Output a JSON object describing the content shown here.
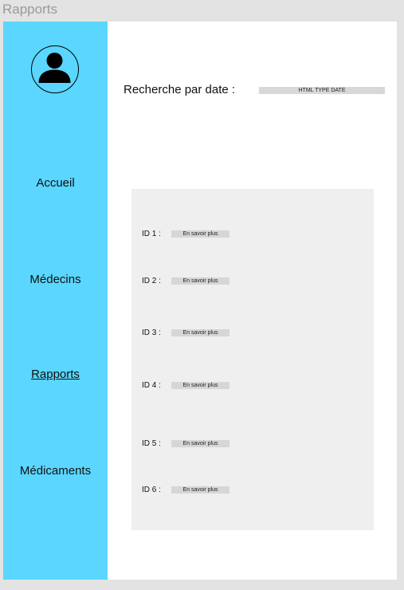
{
  "window": {
    "title": "Rapports"
  },
  "sidebar": {
    "avatar_icon": "user-icon",
    "accent_color": "#5ad6ff",
    "items": [
      {
        "label": "Accueil"
      },
      {
        "label": "Médecins"
      },
      {
        "label": "Rapports",
        "active": true
      },
      {
        "label": "Médicaments"
      }
    ]
  },
  "search": {
    "label": "Recherche par date :",
    "input_value": "HTML TYPE DATE"
  },
  "results": [
    {
      "id_label": "ID 1 :",
      "button_label": "En savoir plus"
    },
    {
      "id_label": "ID 2 :",
      "button_label": "En savoir plus"
    },
    {
      "id_label": "ID 3 :",
      "button_label": "En savoir plus"
    },
    {
      "id_label": "ID 4 :",
      "button_label": "En savoir plus"
    },
    {
      "id_label": "ID 5 :",
      "button_label": "En savoir plus"
    },
    {
      "id_label": "ID 6 :",
      "button_label": "En savoir plus"
    }
  ]
}
